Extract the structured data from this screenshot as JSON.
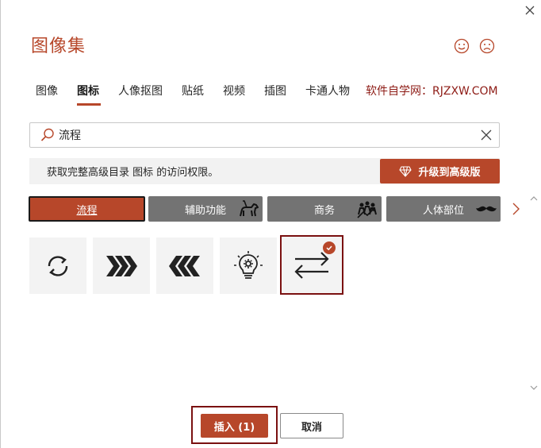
{
  "dialog": {
    "title": "图像集"
  },
  "tabs": [
    {
      "label": "图像"
    },
    {
      "label": "图标"
    },
    {
      "label": "人像抠图"
    },
    {
      "label": "贴纸"
    },
    {
      "label": "视频"
    },
    {
      "label": "插图"
    },
    {
      "label": "卡通人物"
    }
  ],
  "watermark": "软件自学网：RJZXW.COM",
  "search": {
    "value": "流程"
  },
  "banner": {
    "message": "获取完整高级目录 图标 的访问权限。",
    "upgrade_label": "升级到高级版"
  },
  "categories": [
    {
      "label": "流程"
    },
    {
      "label": "辅助功能"
    },
    {
      "label": "商务"
    },
    {
      "label": "人体部位"
    }
  ],
  "icons": [
    {
      "name": "cycle-arrows-icon"
    },
    {
      "name": "chevrons-right-icon"
    },
    {
      "name": "chevrons-left-icon"
    },
    {
      "name": "lightbulb-gear-icon"
    },
    {
      "name": "swap-arrows-icon"
    }
  ],
  "footer": {
    "insert_label": "插入 (1)",
    "cancel_label": "取消"
  },
  "colors": {
    "accent": "#b7472a",
    "selection_border": "#7a1010",
    "category_gray": "#737373"
  }
}
